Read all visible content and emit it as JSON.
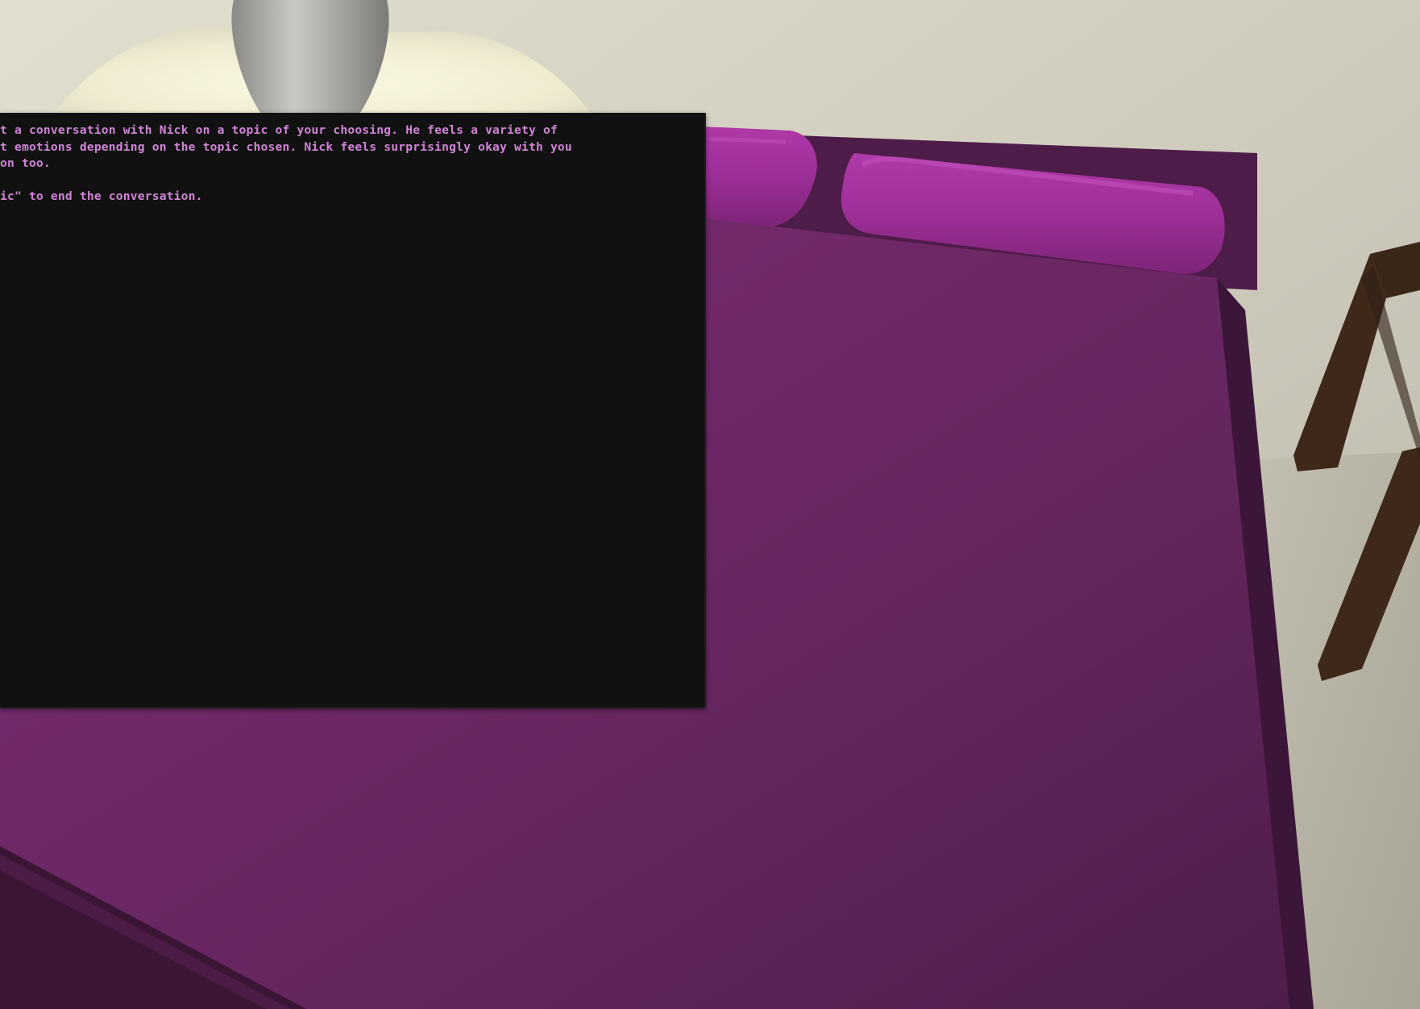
{
  "terminal": {
    "lines": [
      "t a conversation with Nick on a topic of your choosing. He feels a variety of",
      "t emotions depending on the topic chosen. Nick feels surprisingly okay with you",
      "on too.",
      "",
      "ic\" to end the conversation."
    ],
    "text_color": "#d184d6",
    "background": "#111112"
  },
  "scene": {
    "wall_color": "#cfcbbf",
    "bed_color": "#6a2a62",
    "pillow_color": "#a0309c",
    "lamp_color": "#f4f0d6",
    "furniture_color": "#3a2618"
  }
}
